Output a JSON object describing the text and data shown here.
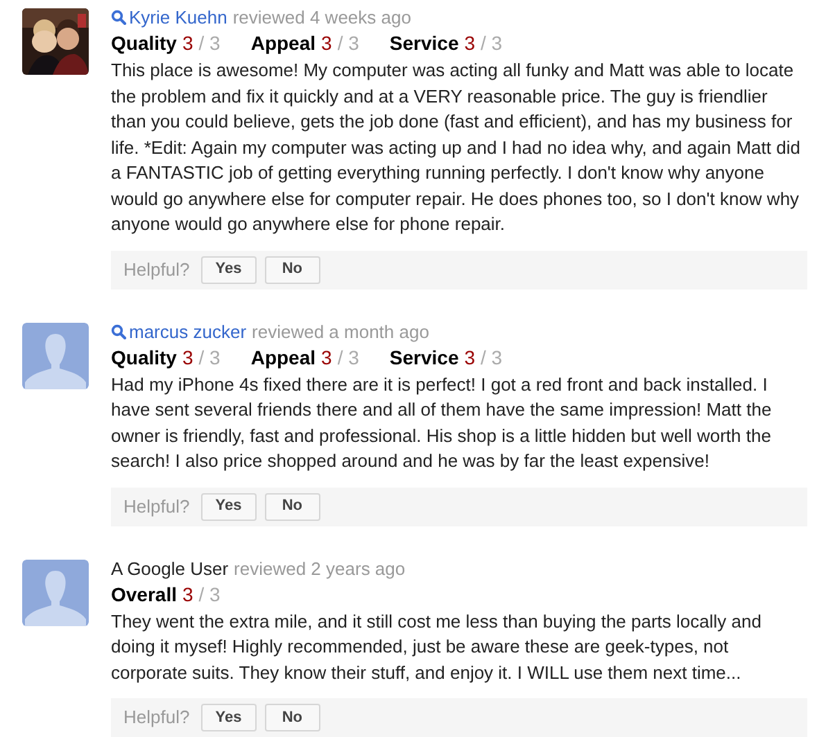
{
  "reviews": [
    {
      "avatar": {
        "kind": "picture"
      },
      "reviewer": "Kyrie Kuehn",
      "linked": true,
      "when": "reviewed 4 weeks ago",
      "scores": [
        {
          "label": "Quality",
          "value": "3",
          "max": "/ 3"
        },
        {
          "label": "Appeal",
          "value": "3",
          "max": "/ 3"
        },
        {
          "label": "Service",
          "value": "3",
          "max": "/ 3"
        }
      ],
      "text": "This place is awesome! My computer was acting all funky and Matt was able to locate the problem and fix it quickly and at a VERY reasonable price. The guy is friendlier than you could believe, gets the job done (fast and efficient), and has my business for life. *Edit: Again my computer was acting up and I had no idea why, and again Matt did a FANTASTIC job of getting everything running perfectly. I don't know why anyone would go anywhere else for computer repair. He does phones too, so I don't know why anyone would go anywhere else for phone repair.",
      "helpful": "Helpful?",
      "buttons": [
        "Yes",
        "No"
      ]
    },
    {
      "avatar": {
        "kind": "silhouette"
      },
      "reviewer": "marcus zucker",
      "linked": true,
      "when": "reviewed a month ago",
      "scores": [
        {
          "label": "Quality",
          "value": "3",
          "max": "/ 3"
        },
        {
          "label": "Appeal",
          "value": "3",
          "max": "/ 3"
        },
        {
          "label": "Service",
          "value": "3",
          "max": "/ 3"
        }
      ],
      "text": "Had my iPhone 4s fixed there are it is perfect! I got a red front and back installed. I have sent several friends there and all of them have the same impression! Matt the owner is friendly, fast and professional. His shop is a little hidden but well worth the search! I also price shopped around and he was by far the least expensive!",
      "helpful": "Helpful?",
      "buttons": [
        "Yes",
        "No"
      ]
    },
    {
      "avatar": {
        "kind": "silhouette"
      },
      "reviewer": "A Google User",
      "linked": false,
      "when": "reviewed 2 years ago",
      "scores": [
        {
          "label": "Overall",
          "value": "3",
          "max": "/ 3"
        }
      ],
      "text": "They went the extra mile, and it still cost me less than buying the parts locally and doing it mysef! Highly recommended, just be aware these are geek-types, not corporate suits. They know their stuff, and enjoy it. I WILL use them next time...",
      "helpful": "Helpful?",
      "buttons": [
        "Yes",
        "No"
      ]
    }
  ]
}
